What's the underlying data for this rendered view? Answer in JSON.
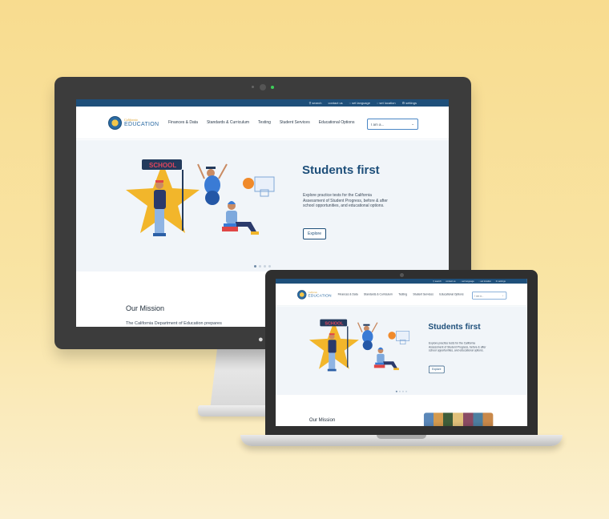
{
  "site": {
    "utility_links": [
      {
        "icon": "search-icon",
        "label": "search"
      },
      {
        "icon": "contact-icon",
        "label": "contact us"
      },
      {
        "icon": "globe-icon",
        "label": "set language"
      },
      {
        "icon": "location-icon",
        "label": "set location"
      },
      {
        "icon": "gear-icon",
        "label": "settings"
      }
    ],
    "logo": {
      "top": "California",
      "sub": "Department of",
      "main": "EDUCATION"
    },
    "nav": [
      "Finances & Data",
      "Standards & Curriculum",
      "Testing",
      "Student Services",
      "Educational Options"
    ],
    "select": {
      "value": "I am a...",
      "icon": "chevron-down-icon"
    },
    "hero": {
      "title": "Students first",
      "body": "Explore practice tests for the California Assessment of Student Progress, before & after school opportunities, and educational options.",
      "button": "Explore",
      "sign_text": "SCHOOL"
    },
    "mission": {
      "title": "Our Mission",
      "text": "The California Department of Education prepares"
    }
  },
  "colors": {
    "background": "#f8dc8f",
    "brand_blue": "#1e4f7a",
    "star_yellow": "#f2b62b"
  }
}
